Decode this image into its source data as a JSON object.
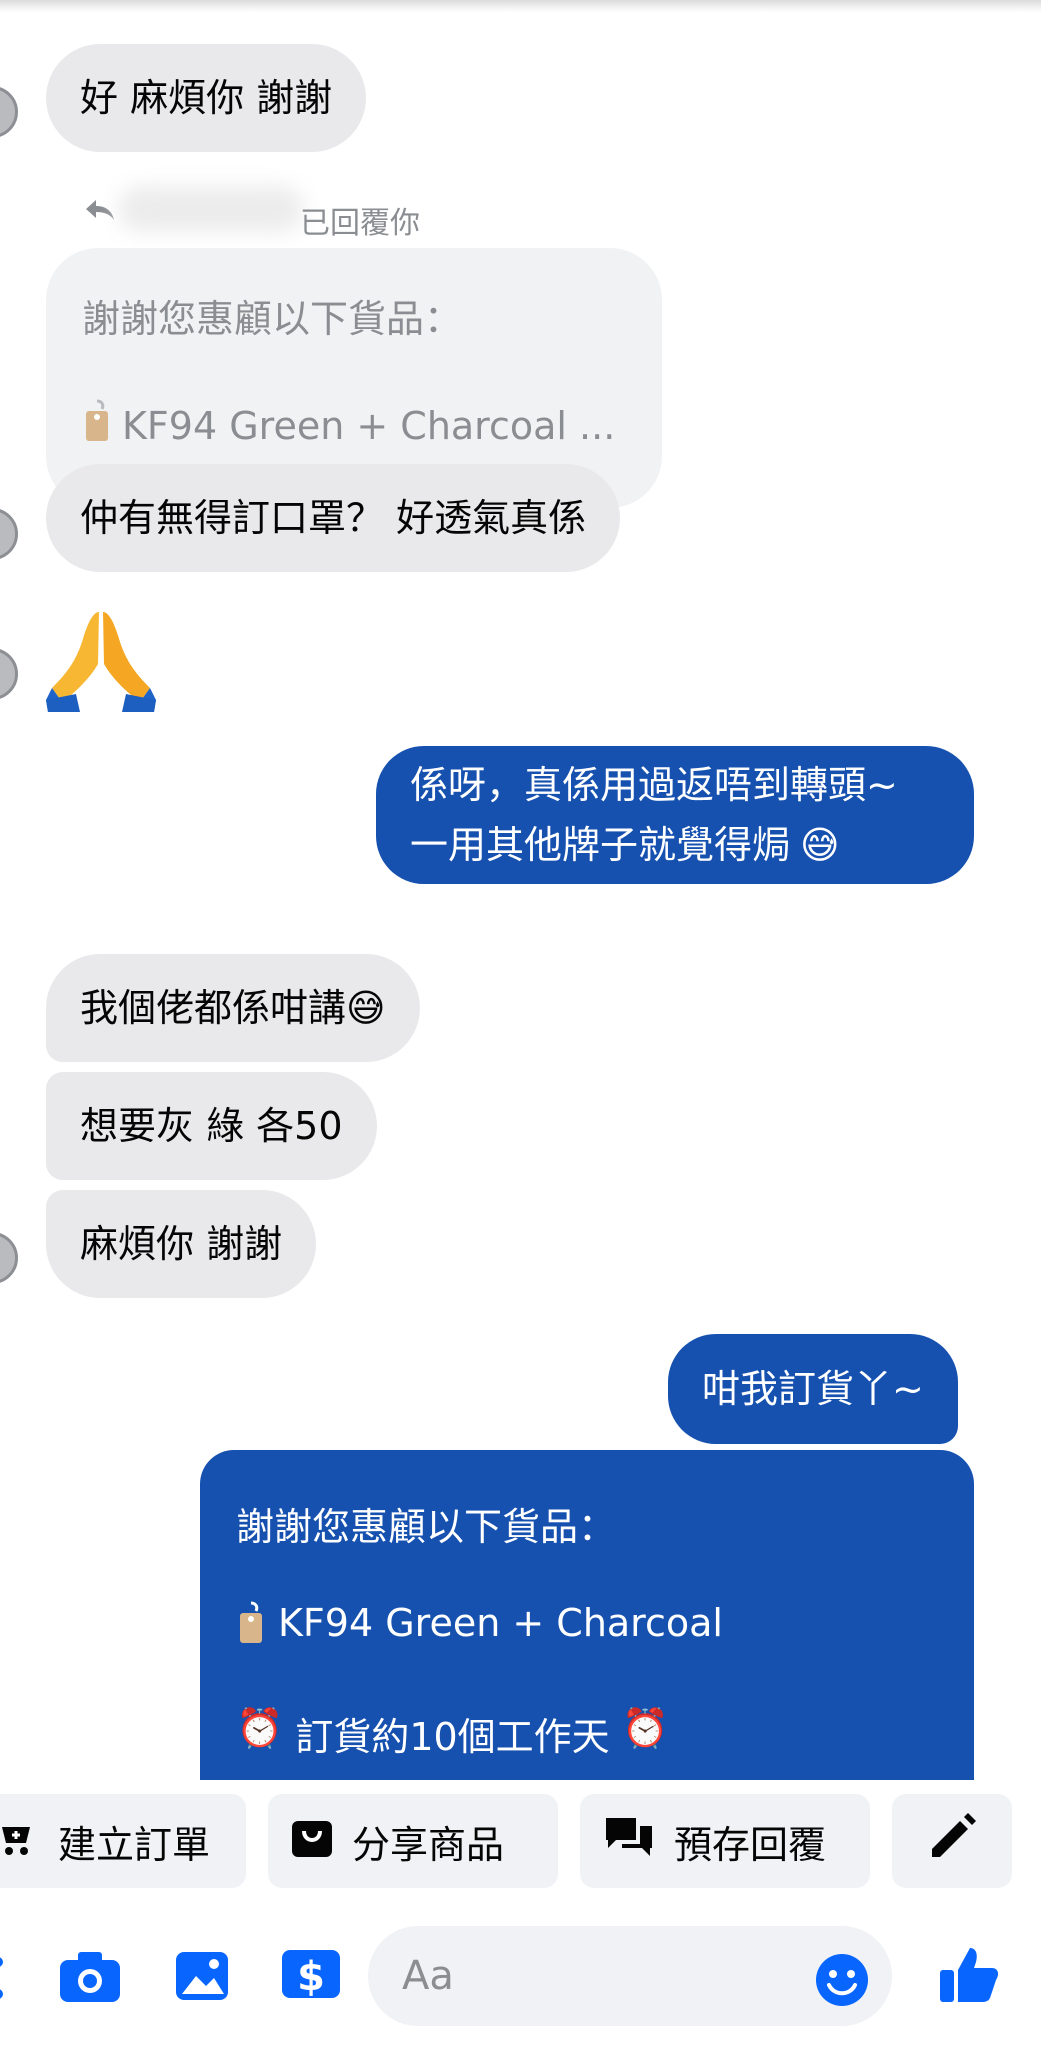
{
  "messages": {
    "m1": "好 麻煩你 謝謝",
    "reply_hint": "已回覆你",
    "quoted_line1": "謝謝您惠顧以下貨品：",
    "quoted_product": "KF94 Green + Charcoal ...",
    "m2": "仲有無得訂口罩？ 好透氣真係",
    "m3_emoji": "🙏",
    "out1_line1": "係呀，真係用過返唔到轉頭~",
    "out1_line2": "一用其他牌子就覺得焗",
    "out1_emoji": "😅",
    "m4": "我個佬都係咁講",
    "m4_emoji": "😅",
    "m5": "想要灰 綠 各50",
    "m6": "麻煩你 謝謝",
    "out2": "咁我訂貨丫~",
    "card_line1": "謝謝您惠顧以下貨品：",
    "card_product": "KF94 Green + Charcoal",
    "card_note_icon": "⏰",
    "card_note": "訂貨約10個工作天"
  },
  "quick_actions": {
    "create_order": "建立訂單",
    "share_product": "分享商品",
    "saved_replies": "預存回覆"
  },
  "composer": {
    "placeholder": "Aa"
  },
  "colors": {
    "outgoing_bubble": "#1651b0",
    "incoming_bubble": "#e9e9eb",
    "accent": "#0866ff"
  }
}
